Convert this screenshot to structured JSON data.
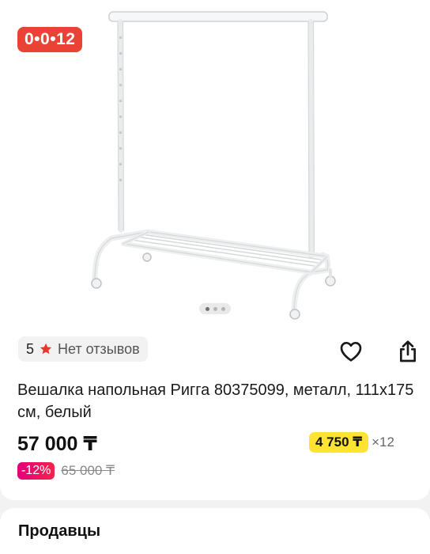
{
  "timer": "0•0•12",
  "rating": {
    "score": "5",
    "reviews_label": "Нет отзывов"
  },
  "product": {
    "title": "Вешалка напольная Ригга 80375099, металл, 111x175 см, белый",
    "price": "57 000 ₸",
    "discount": "-12%",
    "old_price": "65 000 ₸",
    "installment_amount": "4 750 ₸",
    "installment_multiplier": "×12"
  },
  "sellers": {
    "title": "Продавцы"
  },
  "gallery": {
    "total_images": 3,
    "active_index": 0
  },
  "icons": [
    "heart-icon",
    "share-icon",
    "star-icon"
  ],
  "colors": {
    "timer_red": "#ea4335",
    "star_red": "#e8372c",
    "installment_yellow": "#ffe333",
    "discount_pink": "#e4007c"
  }
}
